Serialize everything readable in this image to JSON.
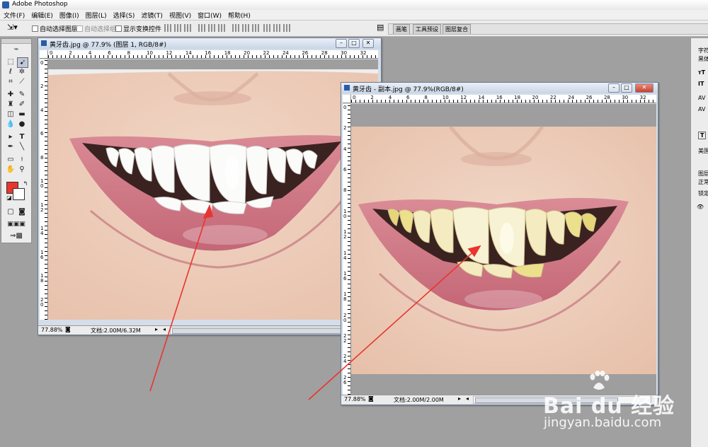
{
  "app": {
    "title": "Adobe Photoshop"
  },
  "menu": [
    "文件(F)",
    "编辑(E)",
    "图像(I)",
    "图层(L)",
    "选择(S)",
    "滤镜(T)",
    "视图(V)",
    "窗口(W)",
    "帮助(H)"
  ],
  "options": {
    "auto_select_layer": "自动选择图层",
    "auto_select_group": "自动选择组",
    "show_transform": "显示变换控件"
  },
  "panel_well": {
    "tabs": [
      "画笔",
      "工具预设",
      "图层复合"
    ]
  },
  "right_panels": {
    "char_tab": "字符",
    "font": "黑体",
    "lang": "美国",
    "layers_tab": "图层",
    "blend": "正常",
    "lock": "锁定:"
  },
  "doc1": {
    "title": "黄牙齿.jpg @ 77.9% (图层 1, RGB/8#)",
    "zoom": "77.88%",
    "doc_size": "文档:2.00M/6.32M",
    "ruler_h": [
      "0",
      "2",
      "4",
      "6",
      "8",
      "10",
      "12",
      "14",
      "16",
      "18",
      "20",
      "22",
      "24",
      "26",
      "28",
      "30",
      "32"
    ],
    "ruler_v": [
      "0",
      "2",
      "4",
      "6",
      "8",
      "10",
      "12",
      "14",
      "16",
      "18",
      "20"
    ]
  },
  "doc2": {
    "title": "黄牙齿 - 副本.jpg @ 77.9%(RGB/8#)",
    "zoom": "77.88%",
    "doc_size": "文档:2.00M/2.00M",
    "ruler_h": [
      "0",
      "2",
      "4",
      "6",
      "8",
      "10",
      "12",
      "14",
      "16",
      "18",
      "20",
      "22",
      "24",
      "26",
      "28",
      "30",
      "32"
    ],
    "ruler_v": [
      "0",
      "2",
      "4",
      "6",
      "8",
      "10",
      "12",
      "14",
      "16",
      "18",
      "20",
      "22",
      "24",
      "26"
    ]
  },
  "colors": {
    "foreground": "#e8362c",
    "background": "#ffffff",
    "arrow": "#e8352f"
  },
  "watermark": {
    "logo": "Bai du 经验",
    "url": "jingyan.baidu.com"
  }
}
